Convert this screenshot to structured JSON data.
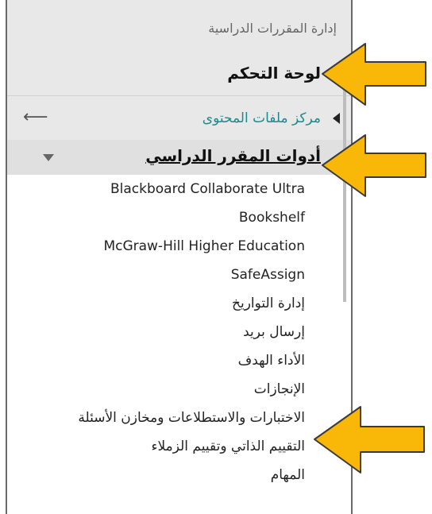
{
  "panel": {
    "section_title": "إدارة المقررات الدراسية",
    "control_panel": "لوحة التحكم",
    "content_collection": "مركز ملفات المحتوى",
    "course_tools": "أدوات المقرر الدراسي",
    "tools": [
      "Blackboard Collaborate Ultra",
      "Bookshelf",
      "McGraw-Hill Higher Education",
      "SafeAssign",
      "إدارة التواريخ",
      "إرسال بريد",
      "الأداء الهدف",
      "الإنجازات",
      "الاختبارات والاستطلاعات ومخازن الأسئلة",
      "التقييم الذاتي وتقييم الزملاء",
      "المهام"
    ]
  },
  "colors": {
    "callout_fill": "#f9b808",
    "callout_stroke": "#3a3a3a",
    "link_teal": "#1a8a8a",
    "header_bg": "#e8e8e8"
  },
  "icons": [
    "left-arrow-icon",
    "expand-triangle-icon",
    "collapse-triangle-icon",
    "callout-arrow-icon"
  ]
}
